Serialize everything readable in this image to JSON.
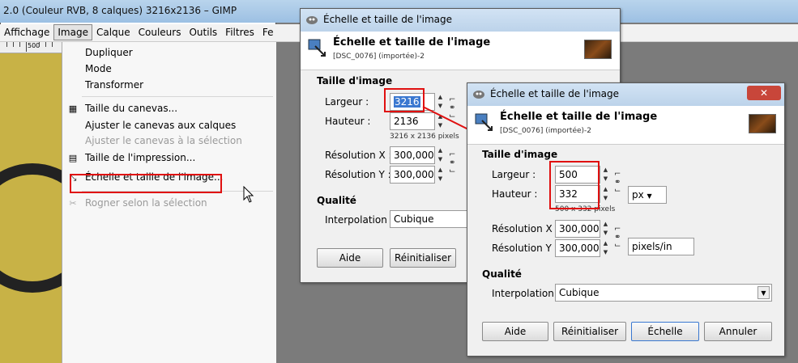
{
  "gimp": {
    "title": "2.0 (Couleur RVB, 8 calques) 3216x2136 – GIMP",
    "menubar": [
      "Affichage",
      "Image",
      "Calque",
      "Couleurs",
      "Outils",
      "Filtres",
      "Fe"
    ],
    "ruler_label": "500",
    "menu_items": [
      {
        "label": "Dupliquer",
        "disabled": false
      },
      {
        "label": "Mode",
        "disabled": false
      },
      {
        "label": "Transformer",
        "disabled": false
      },
      {
        "label": "Taille du canevas...",
        "disabled": false
      },
      {
        "label": "Ajuster le canevas aux calques",
        "disabled": false
      },
      {
        "label": "Ajuster le canevas à la sélection",
        "disabled": true
      },
      {
        "label": "Taille de l'impression...",
        "disabled": false
      },
      {
        "label": "Échelle et taille de l'image...",
        "disabled": false
      },
      {
        "label": "Rogner selon la sélection",
        "disabled": true
      }
    ]
  },
  "dialog1": {
    "window_title": "Échelle et taille de l'image",
    "header_title": "Échelle et taille de l'image",
    "header_sub": "[DSC_0076] (importée)-2",
    "section_size": "Taille d'image",
    "width_label": "Largeur :",
    "width_value": "3216",
    "height_label": "Hauteur :",
    "height_value": "2136",
    "pixel_info": "3216 x 2136 pixels",
    "resx_label": "Résolution X :",
    "resx_value": "300,000",
    "resy_label": "Résolution Y :",
    "resy_value": "300,000",
    "section_quality": "Qualité",
    "interp_label": "Interpolation :",
    "interp_value": "Cubique",
    "btn_help": "Aide",
    "btn_reset": "Réinitialiser"
  },
  "dialog2": {
    "window_title": "Échelle et taille de l'image",
    "header_title": "Échelle et taille de l'image",
    "header_sub": "[DSC_0076] (importée)-2",
    "section_size": "Taille d'image",
    "width_label": "Largeur :",
    "width_value": "500",
    "height_label": "Hauteur :",
    "height_value": "332",
    "pixel_info": "500 x 332 pixels",
    "unit_value": "px",
    "resx_label": "Résolution X :",
    "resx_value": "300,000",
    "resy_label": "Résolution Y :",
    "resy_value": "300,000",
    "res_unit_value": "pixels/in",
    "section_quality": "Qualité",
    "interp_label": "Interpolation :",
    "interp_value": "Cubique",
    "btn_help": "Aide",
    "btn_reset": "Réinitialiser",
    "btn_scale": "Échelle",
    "btn_cancel": "Annuler"
  },
  "colors": {
    "highlight_red": "#e01010",
    "selection_blue": "#3a78d0",
    "close_red": "#c8463a"
  }
}
